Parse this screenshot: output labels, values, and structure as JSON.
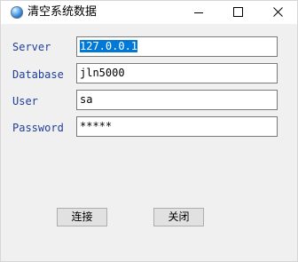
{
  "window": {
    "title": "清空系统数据",
    "controls": {
      "minimize_icon": "minimize-icon",
      "maximize_icon": "maximize-icon",
      "close_icon": "close-icon"
    }
  },
  "form": {
    "server": {
      "label": "Server",
      "value": "127.0.0.1"
    },
    "database": {
      "label": "Database",
      "value": "jln5000"
    },
    "user": {
      "label": "User",
      "value": "sa"
    },
    "password": {
      "label": "Password",
      "value": "*****"
    }
  },
  "buttons": {
    "connect_label": "连接",
    "close_label": "关闭"
  },
  "colors": {
    "label_text": "#1f3f99",
    "selection": "#0078d7",
    "window_bg": "#f0f0f0"
  }
}
